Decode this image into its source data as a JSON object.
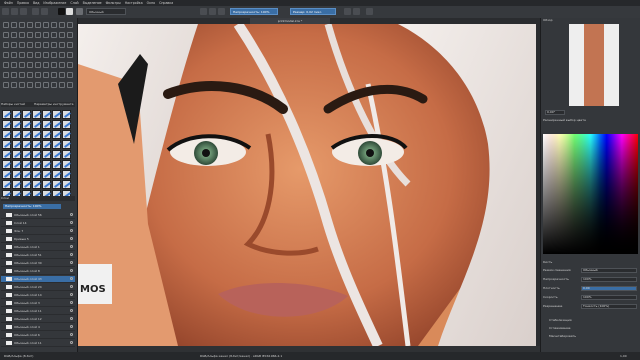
{
  "menu": [
    "Файл",
    "Правка",
    "Вид",
    "Изображение",
    "Слой",
    "Выделение",
    "Фильтры",
    "Настройка",
    "Окно",
    "Справка"
  ],
  "toolbar": {
    "preset_name": "Обычный",
    "opacity_label": "Непрозрачность: 100%",
    "size_label": "Размер: 0,02 пикс."
  },
  "canvas_tab": "printmodel.kra *",
  "left_dock": {
    "brush_presets_title": "Наборы кистей",
    "brush_tags_title": "Параметры инструмента",
    "layers_title": "Слои",
    "layers_blend": "Непрозрачность: 100%",
    "layers": [
      "Обычный слой 56",
      "Слой 14",
      "Фон 7",
      "Кривые 5",
      "Обычный слой 1",
      "Обычный слой 51",
      "Обычный слой 30",
      "Обычный слой 8",
      "Обычный слой 43",
      "Обычный слой 24",
      "Обычный слой 14",
      "Обычный слой 3",
      "Обычный слой 11",
      "Обычный слой 12",
      "Обычный слой 4",
      "Обычный слой 6",
      "Обычный слой 11"
    ]
  },
  "right_dock": {
    "overview_title": "Обзор",
    "zoom_value": "0,00°",
    "color_title": "Расширенный выбор цвета",
    "brush_settings_title": "Кисть",
    "fields": [
      {
        "label": "Режим смешения",
        "value": "Обычный"
      },
      {
        "label": "Непрозрачность",
        "value": "100%"
      },
      {
        "label": "Плотность",
        "value": "0,00"
      },
      {
        "label": "Скорость",
        "value": "100%"
      },
      {
        "label": "Разрешение",
        "value": "Тонкость (100%)"
      }
    ],
    "options": [
      "Стабилизация",
      "Сглаживание",
      "Масштабировать"
    ]
  },
  "canvas_text": "MOS",
  "statusbar": {
    "left": "RGB/Альфа (8-бит)",
    "center": "RGB/Альфа канал (8-бит/канал) · sRGB IEC61966-2.1",
    "right": "1,00"
  },
  "colors": {
    "accent": "#3a6ea5",
    "panel": "#34373b",
    "dark": "#26282b"
  }
}
